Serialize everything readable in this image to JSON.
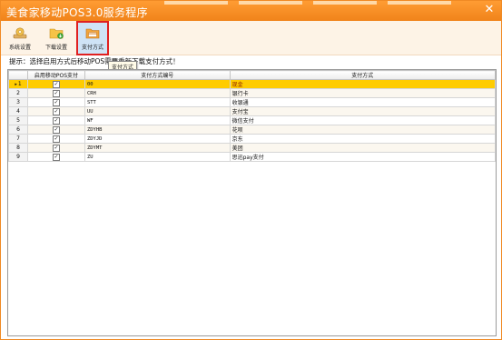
{
  "window": {
    "title": "美食家移动POS3.0服务程序",
    "close_glyph": "✕"
  },
  "toolbar": [
    {
      "label": "系统设置",
      "icon": "settings-icon",
      "active": false
    },
    {
      "label": "下载设置",
      "icon": "download-folder-icon",
      "active": false
    },
    {
      "label": "支付方式",
      "icon": "payment-card-icon",
      "active": true
    }
  ],
  "tooltip": "支付方式",
  "hint": "提示：选择启用方式后移动POS需要重新下载支付方式！",
  "table": {
    "columns": [
      "",
      "启用移动POS支付",
      "支付方式编号",
      "支付方式"
    ],
    "rows": [
      {
        "no": "1",
        "enabled": true,
        "code": "00",
        "name": "现金",
        "selected": true
      },
      {
        "no": "2",
        "enabled": true,
        "code": "CRH",
        "name": "银行卡"
      },
      {
        "no": "3",
        "enabled": true,
        "code": "STT",
        "name": "收银通"
      },
      {
        "no": "4",
        "enabled": true,
        "code": "UU",
        "name": "支付宝"
      },
      {
        "no": "5",
        "enabled": true,
        "code": "WF",
        "name": "微信支付"
      },
      {
        "no": "6",
        "enabled": true,
        "code": "ZDYHB",
        "name": "花呗"
      },
      {
        "no": "7",
        "enabled": true,
        "code": "ZDYJD",
        "name": "京东"
      },
      {
        "no": "8",
        "enabled": true,
        "code": "ZDYMT",
        "name": "美团"
      },
      {
        "no": "9",
        "enabled": true,
        "code": "ZU",
        "name": "思迅pay支付"
      }
    ]
  },
  "colors": {
    "title_bar": "#f0831a",
    "selected_row": "#ffcc00",
    "active_tool_border": "#e02020"
  }
}
